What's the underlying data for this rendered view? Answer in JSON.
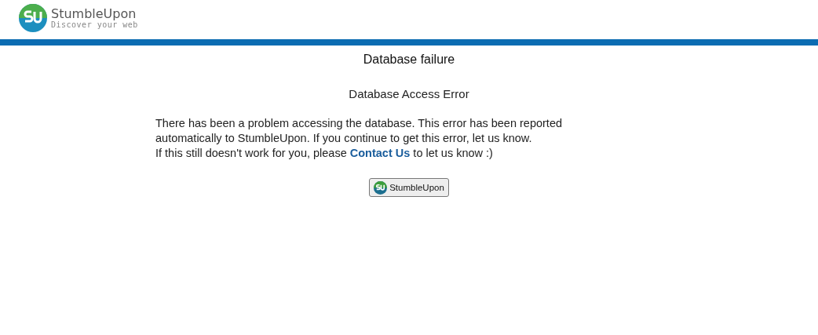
{
  "header": {
    "brand": "StumbleUpon",
    "tagline": "Discover your web"
  },
  "title": "Database failure",
  "subtitle": "Database Access Error",
  "message": [
    "There has been a problem accessing the database. This error has been reported",
    "automatically to StumbleUpon. If you continue to get this error, let us know."
  ],
  "help": {
    "before": "If this still doesn't work for you, please ",
    "link": "Contact Us",
    "after": " to let us know :)"
  },
  "button": "StumbleUpon"
}
